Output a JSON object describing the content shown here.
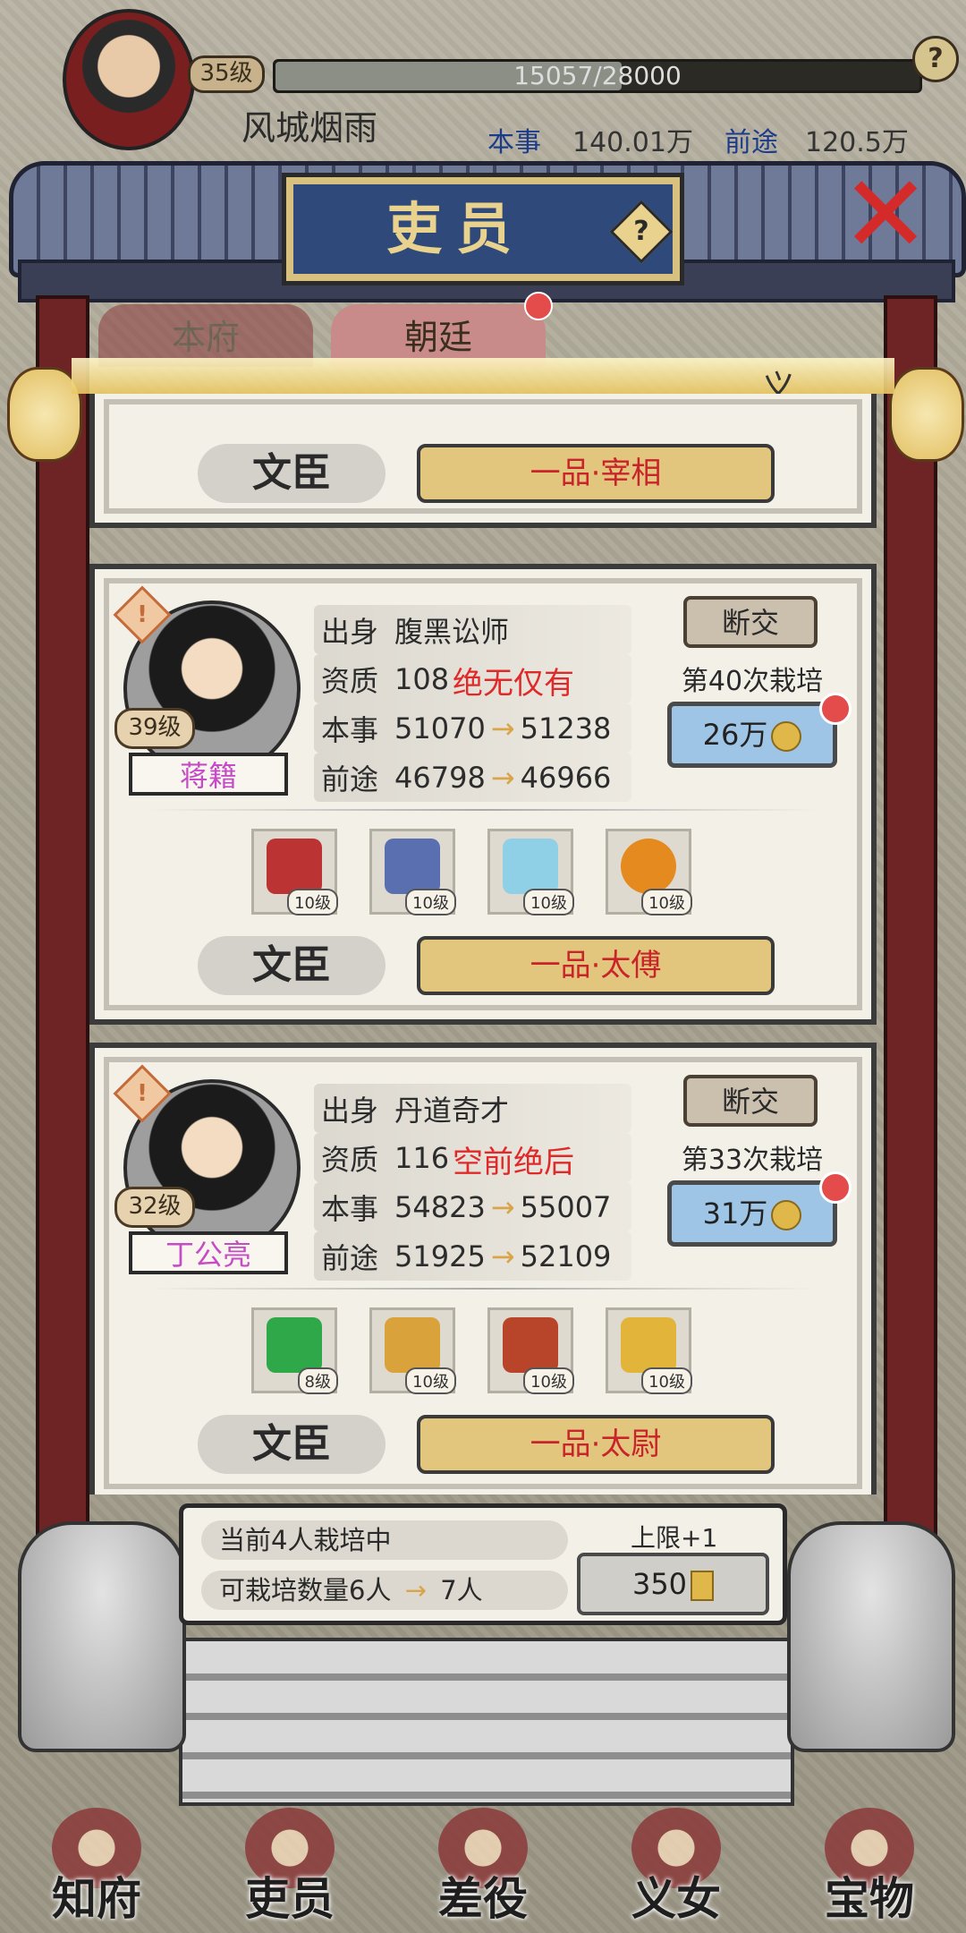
{
  "player": {
    "level": "35级",
    "exp": "15057/28000",
    "exp_fraction": 0.5377,
    "name": "风城烟雨",
    "stat1_label": "本事",
    "stat1_value": "140.01万",
    "stat2_label": "前途",
    "stat2_value": "120.5万"
  },
  "title": "吏员",
  "tabs": [
    "本府",
    "朝廷"
  ],
  "glow_text": "义",
  "partial_card": {
    "category": "文臣",
    "rank": "一品·宰相"
  },
  "officials": [
    {
      "level": "39级",
      "name": "蒋籍",
      "origin_label": "出身",
      "origin": "腹黑讼师",
      "quality_label": "资质",
      "quality": "108",
      "trait": "绝无仅有",
      "skill_label": "本事",
      "skill_from": "51070",
      "skill_to": "51238",
      "future_label": "前途",
      "future_from": "46798",
      "future_to": "46966",
      "break_label": "断交",
      "cultivate_count": "第40次栽培",
      "cost": "26万",
      "items": [
        {
          "icon": "sword-icon",
          "level": "10级",
          "color": "#b33"
        },
        {
          "icon": "robe-icon",
          "level": "10级",
          "color": "#5a6fb0"
        },
        {
          "icon": "bowl-icon",
          "level": "10级",
          "color": "#8fd0e6"
        },
        {
          "icon": "orb-icon",
          "level": "10级",
          "color": "#e58a1f"
        }
      ],
      "category": "文臣",
      "rank": "一品·太傅"
    },
    {
      "level": "32级",
      "name": "丁公亮",
      "origin_label": "出身",
      "origin": "丹道奇才",
      "quality_label": "资质",
      "quality": "116",
      "trait": "空前绝后",
      "skill_label": "本事",
      "skill_from": "54823",
      "skill_to": "55007",
      "future_label": "前途",
      "future_from": "51925",
      "future_to": "52109",
      "break_label": "断交",
      "cultivate_count": "第33次栽培",
      "cost": "31万",
      "items": [
        {
          "icon": "jade-icon",
          "level": "8级",
          "color": "#2fa84a"
        },
        {
          "icon": "lamp-icon",
          "level": "10级",
          "color": "#d9a23a"
        },
        {
          "icon": "sword-icon",
          "level": "10级",
          "color": "#b8452a"
        },
        {
          "icon": "robe-icon",
          "level": "10级",
          "color": "#e2b43a"
        }
      ],
      "category": "文臣",
      "rank": "一品·太尉"
    }
  ],
  "summary": {
    "current": "当前4人栽培中",
    "capacity_text": "可栽培数量6人",
    "capacity_next": "7人",
    "cap_label": "上限+1",
    "cap_cost": "350"
  },
  "nav": [
    "知府",
    "吏员",
    "差役",
    "义女",
    "宝物"
  ],
  "colors": {
    "accent_red": "#e02a2a",
    "name_purple": "#c64cc6",
    "cost_blue": "#9fc5e6"
  }
}
